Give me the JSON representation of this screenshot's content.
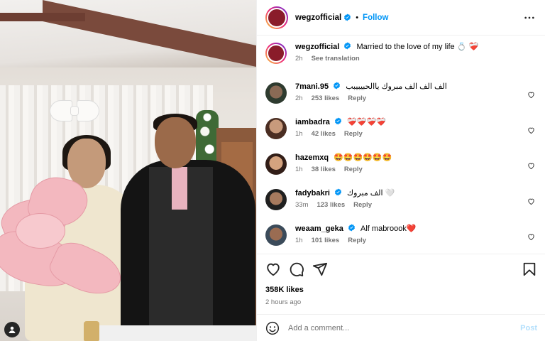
{
  "post": {
    "author": "wegzofficial",
    "follow_label": "Follow",
    "separator": "•",
    "caption": {
      "username": "wegzofficial",
      "text": "Married to the love of my life 💍 ❤️‍🩹",
      "time": "2h",
      "translate": "See translation"
    },
    "comments": [
      {
        "username": "7mani.95",
        "text": "الف الف الف مبروك ياالحبيبيبب",
        "time": "2h",
        "likes": "253 likes",
        "reply": "Reply"
      },
      {
        "username": "iambadra",
        "text": "❤️‍🩹❤️‍🩹❤️‍🩹❤️‍🩹",
        "time": "1h",
        "likes": "42 likes",
        "reply": "Reply"
      },
      {
        "username": "hazemxq",
        "text": "🤩🤩🤩🤩🤩🤩",
        "time": "1h",
        "likes": "38 likes",
        "reply": "Reply"
      },
      {
        "username": "fadybakri",
        "text": "الف مبروك 🤍",
        "time": "33m",
        "likes": "123 likes",
        "reply": "Reply"
      },
      {
        "username": "weaam_geka",
        "text": "Alf mabroook❤️",
        "time": "1h",
        "likes": "101 likes",
        "reply": "Reply"
      }
    ],
    "likes": "358K likes",
    "time_ago": "2 hours ago",
    "add_comment_placeholder": "Add a comment...",
    "post_label": "Post"
  },
  "colors": {
    "accent": "#0095f6",
    "verified": "#0095f6",
    "muted": "#737373",
    "post_disabled": "#b2dffc"
  }
}
